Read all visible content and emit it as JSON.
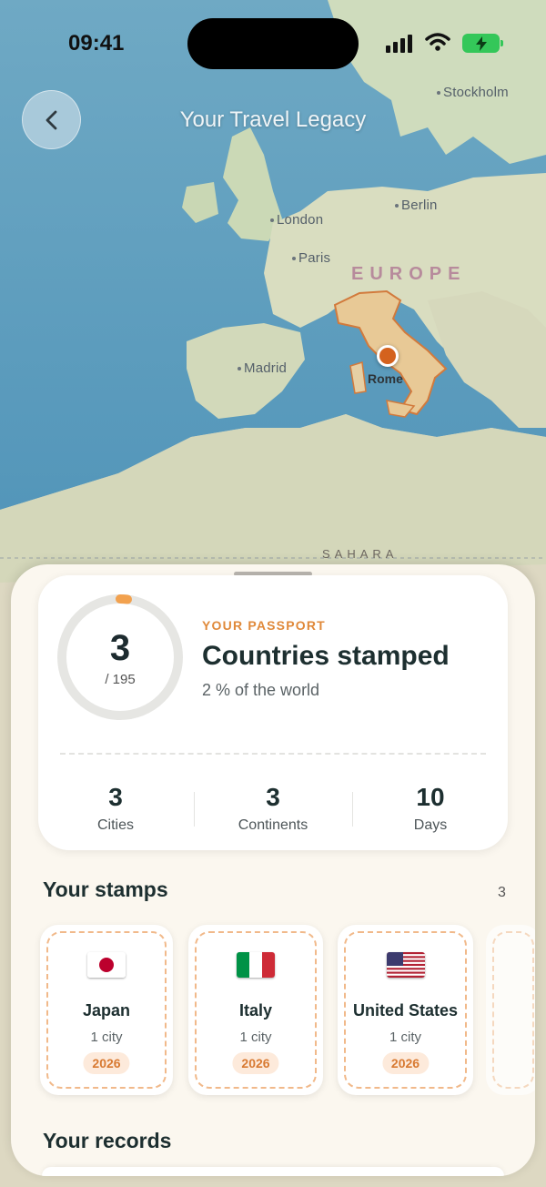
{
  "status_bar": {
    "time": "09:41"
  },
  "header": {
    "title": "Your Travel Legacy"
  },
  "map": {
    "places": [
      "Stockholm",
      "London",
      "Berlin",
      "Paris",
      "Madrid",
      "Rome"
    ],
    "regions": [
      "EUROPE",
      "SAHARA"
    ],
    "highlight_color": "#d4621e"
  },
  "passport": {
    "count": "3",
    "total": "/ 195",
    "kicker": "YOUR PASSPORT",
    "title": "Countries stamped",
    "subtitle": "2 % of the world",
    "progress_fraction": 0.0154,
    "stats": [
      {
        "value": "3",
        "label": "Cities"
      },
      {
        "value": "3",
        "label": "Continents"
      },
      {
        "value": "10",
        "label": "Days"
      }
    ]
  },
  "stamps": {
    "title": "Your stamps",
    "count": "3",
    "items": [
      {
        "country": "Japan",
        "cities": "1 city",
        "year": "2026",
        "flag": "japan-flag-icon"
      },
      {
        "country": "Italy",
        "cities": "1 city",
        "year": "2026",
        "flag": "italy-flag-icon"
      },
      {
        "country": "United States",
        "cities": "1 city",
        "year": "2026",
        "flag": "usa-flag-icon"
      }
    ]
  },
  "records": {
    "title": "Your records"
  },
  "colors": {
    "accent": "#e0893a",
    "text_dark": "#1d2f30",
    "sheet_bg": "#fbf7ef"
  }
}
